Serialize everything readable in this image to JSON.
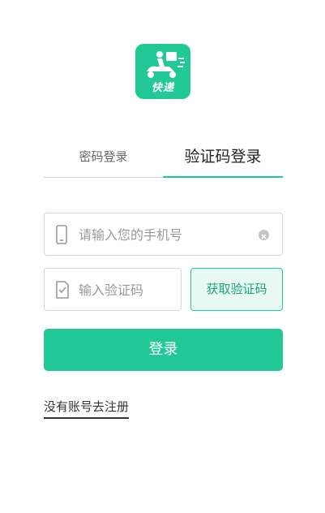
{
  "logo": {
    "text": "快递"
  },
  "tabs": [
    {
      "label": "密码登录",
      "active": false
    },
    {
      "label": "验证码登录",
      "active": true
    }
  ],
  "phone": {
    "placeholder": "请输入您的手机号",
    "value": ""
  },
  "code": {
    "placeholder": "输入验证码",
    "value": "",
    "get_code_label": "获取验证码"
  },
  "login": {
    "label": "登录"
  },
  "register": {
    "label": "没有账号去注册"
  },
  "colors": {
    "accent": "#22c896",
    "accent_light": "#e8f8f2",
    "text": "#333333",
    "placeholder": "#999999"
  }
}
